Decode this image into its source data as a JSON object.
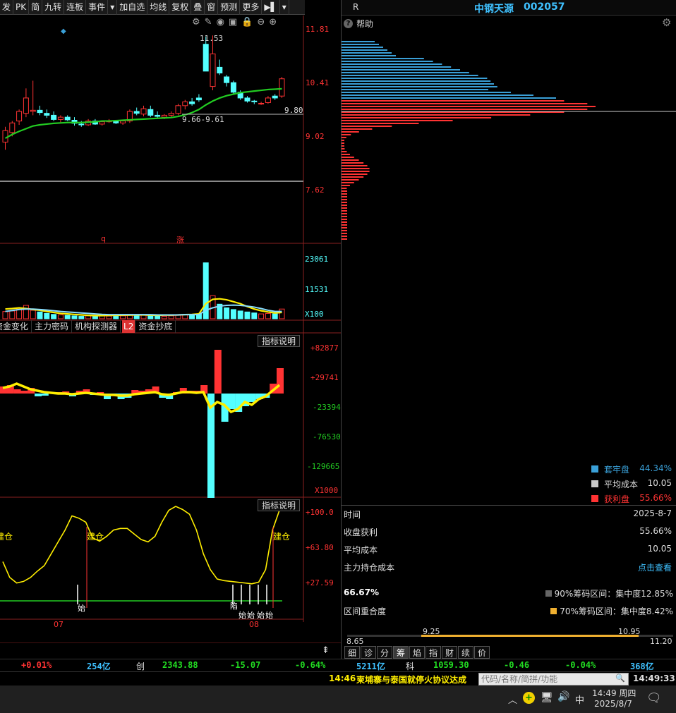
{
  "toolbar": {
    "items": [
      "发",
      "PK",
      "简",
      "九转",
      "连板",
      "事件",
      "▾",
      "加自选",
      "均线",
      "复权",
      "叠",
      "窗",
      "预测",
      "更多",
      "▶▌",
      "▾"
    ]
  },
  "price_axis": {
    "labels": [
      "11.81",
      "10.41",
      "9.02",
      "7.62"
    ]
  },
  "price_annotations": {
    "high": "11.53",
    "range": "9.66-9.61",
    "last": "9.80"
  },
  "event_markers": {
    "m1": "q",
    "m2": "涨"
  },
  "volume_axis": {
    "labels": [
      "23061",
      "11531",
      "X100"
    ]
  },
  "subtabs": [
    "资金变化",
    "主力密码",
    "机构探测器",
    "L2",
    "资金抄底"
  ],
  "ind1": {
    "button": "指标说明",
    "labels": [
      "+82877",
      "+29741",
      "-23394",
      "-76530",
      "-129665",
      "X1000"
    ]
  },
  "ind2": {
    "button": "指标说明",
    "labels": [
      "+100.0",
      "+63.80",
      "+27.59"
    ],
    "signal_text": "建仓",
    "bottom_marks": [
      "始",
      "陷",
      "始",
      "始",
      "始",
      "始"
    ]
  },
  "time_axis": {
    "labels": [
      "07",
      "08"
    ]
  },
  "right_title": {
    "r": "R",
    "name": "中钢天源",
    "code": "002057"
  },
  "help": {
    "label": "帮助"
  },
  "legend": [
    {
      "label": "套牢盘",
      "value": "44.34%",
      "color": "#3aa0d8"
    },
    {
      "label": "平均成本",
      "value": "10.05",
      "color": "#c8c8c8"
    },
    {
      "label": "获利盘",
      "value": "55.66%",
      "color": "#ff3333"
    }
  ],
  "stats": {
    "date_k": "时间",
    "date_v": "2025-8-7",
    "profit_k": "收盘获利",
    "profit_v": "55.66%",
    "avg_k": "平均成本",
    "avg_v": "10.05",
    "main_k": "主力持仓成本",
    "main_v": "点击查看",
    "overlap_pct": "66.67%",
    "overlap_k": "区间重合度",
    "c90": "90%筹码区间：集中度12.85%",
    "c70": "70%筹码区间：集中度8.42%"
  },
  "range_bar": {
    "low": "8.65",
    "p1": "9.25",
    "p2": "10.95",
    "high": "11.20"
  },
  "bottom_tabs": [
    "细",
    "诊",
    "分",
    "筹",
    "焰",
    "指",
    "财",
    "续",
    "价"
  ],
  "ticker": {
    "t1": "+0.01%",
    "t2": "254亿",
    "t3": "创",
    "t4": "2343.88",
    "t5": "-15.07",
    "t6": "-0.64%",
    "t7": "5211亿",
    "t8": "科",
    "t9": "1059.30",
    "t10": "-0.46",
    "t11": "-0.04%",
    "t12": "368亿"
  },
  "news": {
    "time": "14:46",
    "text": "柬埔寨与泰国就停火协议达成",
    "search_placeholder": "代码/名称/简拼/功能",
    "clock": "14:49:33"
  },
  "taskbar": {
    "time": "14:49 周四",
    "date": "2025/8/7",
    "ime": "中"
  },
  "colors": {
    "up": "#ff3333",
    "down": "#54ffff",
    "ma": "#22cc22",
    "yellow": "#ffee00"
  }
}
